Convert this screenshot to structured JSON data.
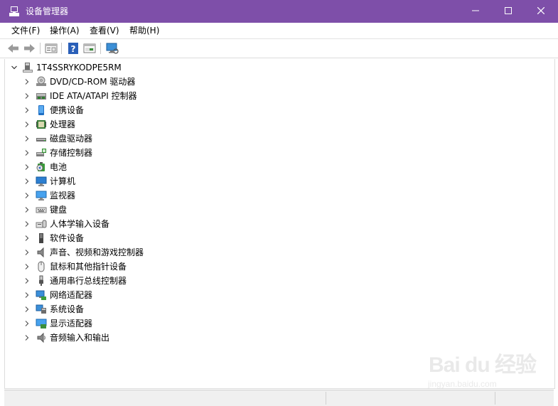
{
  "window": {
    "title": "设备管理器",
    "minimize_glyph": "—",
    "titlebar_color": "#7e4fa9"
  },
  "menubar": {
    "items": [
      "文件(F)",
      "操作(A)",
      "查看(V)",
      "帮助(H)"
    ]
  },
  "toolbar": {
    "buttons": [
      "back-arrow-icon",
      "forward-arrow-icon",
      "properties-icon",
      "help-icon",
      "update-driver-icon",
      "scan-hardware-icon"
    ]
  },
  "tree": {
    "root": {
      "label": "1T4SSRYKODPE5RM",
      "icon": "computer-icon"
    },
    "categories": [
      {
        "label": "DVD/CD-ROM 驱动器",
        "icon": "dvd-drive-icon"
      },
      {
        "label": "IDE ATA/ATAPI 控制器",
        "icon": "ide-controller-icon"
      },
      {
        "label": "便携设备",
        "icon": "portable-device-icon"
      },
      {
        "label": "处理器",
        "icon": "processor-icon"
      },
      {
        "label": "磁盘驱动器",
        "icon": "disk-drive-icon"
      },
      {
        "label": "存储控制器",
        "icon": "storage-controller-icon"
      },
      {
        "label": "电池",
        "icon": "battery-icon"
      },
      {
        "label": "计算机",
        "icon": "computer-monitor-icon"
      },
      {
        "label": "监视器",
        "icon": "monitor-icon"
      },
      {
        "label": "键盘",
        "icon": "keyboard-icon"
      },
      {
        "label": "人体学输入设备",
        "icon": "hid-icon"
      },
      {
        "label": "软件设备",
        "icon": "software-device-icon"
      },
      {
        "label": "声音、视频和游戏控制器",
        "icon": "sound-icon"
      },
      {
        "label": "鼠标和其他指针设备",
        "icon": "mouse-icon"
      },
      {
        "label": "通用串行总线控制器",
        "icon": "usb-icon"
      },
      {
        "label": "网络适配器",
        "icon": "network-adapter-icon"
      },
      {
        "label": "系统设备",
        "icon": "system-device-icon"
      },
      {
        "label": "显示适配器",
        "icon": "display-adapter-icon"
      },
      {
        "label": "音频输入和输出",
        "icon": "audio-io-icon"
      }
    ]
  },
  "watermark": {
    "logo": "Bai du 经验",
    "url": "jingyan.baidu.com"
  }
}
